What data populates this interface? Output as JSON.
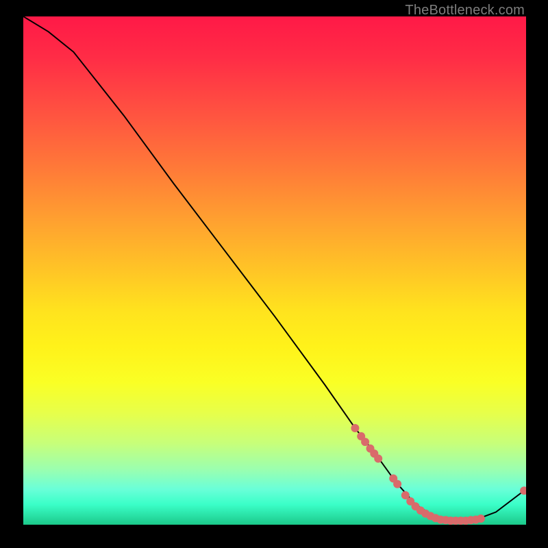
{
  "watermark": "TheBottleneck.com",
  "chart_data": {
    "type": "line",
    "title": "",
    "xlabel": "",
    "ylabel": "",
    "xlim": [
      0,
      100
    ],
    "ylim": [
      0,
      100
    ],
    "grid": false,
    "series": [
      {
        "name": "curve",
        "points": [
          {
            "x": 0,
            "y": 100
          },
          {
            "x": 5,
            "y": 97
          },
          {
            "x": 10,
            "y": 93
          },
          {
            "x": 20,
            "y": 80.5
          },
          {
            "x": 30,
            "y": 67
          },
          {
            "x": 40,
            "y": 54
          },
          {
            "x": 50,
            "y": 41
          },
          {
            "x": 60,
            "y": 27.5
          },
          {
            "x": 66,
            "y": 19
          },
          {
            "x": 70,
            "y": 14
          },
          {
            "x": 74,
            "y": 8.5
          },
          {
            "x": 78,
            "y": 4
          },
          {
            "x": 82,
            "y": 1.5
          },
          {
            "x": 86,
            "y": 0.8
          },
          {
            "x": 90,
            "y": 1
          },
          {
            "x": 94,
            "y": 2.5
          },
          {
            "x": 100,
            "y": 7
          }
        ]
      }
    ],
    "scatter_points": [
      {
        "x": 66.0,
        "y": 19.0
      },
      {
        "x": 67.2,
        "y": 17.4
      },
      {
        "x": 68.0,
        "y": 16.3
      },
      {
        "x": 69.0,
        "y": 15.0
      },
      {
        "x": 69.8,
        "y": 14.0
      },
      {
        "x": 70.6,
        "y": 13.0
      },
      {
        "x": 73.6,
        "y": 9.1
      },
      {
        "x": 74.4,
        "y": 8.0
      },
      {
        "x": 76.0,
        "y": 5.8
      },
      {
        "x": 77.0,
        "y": 4.6
      },
      {
        "x": 78.0,
        "y": 3.6
      },
      {
        "x": 79.0,
        "y": 2.8
      },
      {
        "x": 80.0,
        "y": 2.2
      },
      {
        "x": 81.0,
        "y": 1.7
      },
      {
        "x": 82.0,
        "y": 1.3
      },
      {
        "x": 83.0,
        "y": 1.0
      },
      {
        "x": 84.0,
        "y": 0.9
      },
      {
        "x": 85.0,
        "y": 0.8
      },
      {
        "x": 86.0,
        "y": 0.8
      },
      {
        "x": 87.0,
        "y": 0.8
      },
      {
        "x": 88.0,
        "y": 0.8
      },
      {
        "x": 89.0,
        "y": 0.9
      },
      {
        "x": 90.0,
        "y": 1.0
      },
      {
        "x": 91.0,
        "y": 1.2
      },
      {
        "x": 99.6,
        "y": 6.7
      }
    ],
    "colors": {
      "curve": "#000000",
      "dots": "#d96b6b",
      "bg_top": "#ff1947",
      "bg_bottom": "#1cc98a"
    }
  }
}
